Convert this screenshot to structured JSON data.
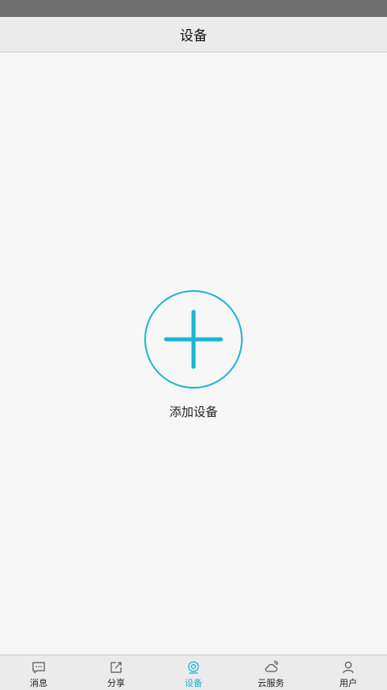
{
  "header": {
    "title": "设备"
  },
  "main": {
    "add_label": "添加设备"
  },
  "tabbar": {
    "tabs": [
      {
        "label": "消息",
        "icon": "message-icon"
      },
      {
        "label": "分享",
        "icon": "share-icon"
      },
      {
        "label": "设备",
        "icon": "device-icon",
        "active": true
      },
      {
        "label": "云服务",
        "icon": "cloud-icon"
      },
      {
        "label": "用户",
        "icon": "user-icon"
      }
    ]
  },
  "colors": {
    "accent": "#1bb4d3",
    "status_bar": "#6e6e6e",
    "header_bg": "#ebebeb",
    "page_bg": "#f7f7f7"
  }
}
